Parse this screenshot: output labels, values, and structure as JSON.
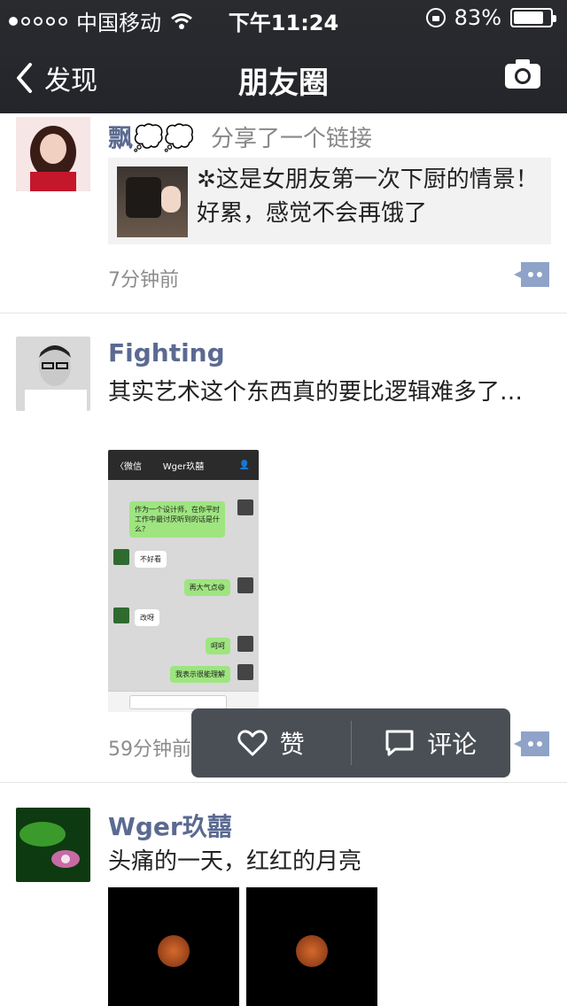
{
  "status_bar": {
    "carrier": "中国移动",
    "time": "下午11:24",
    "battery": "83%",
    "battery_fraction": 0.83,
    "signal_filled": 1,
    "signal_total": 5
  },
  "nav": {
    "back_label": "发现",
    "title": "朋友圈",
    "camera_icon": "camera-icon"
  },
  "posts": [
    {
      "author": "飘💭💭",
      "share_text": "分享了一个链接",
      "link_text": "✲这是女朋友第一次下厨的情景！好累，感觉不会再饿了",
      "time": "7分钟前"
    },
    {
      "author": "Fighting",
      "text": "其实艺术这个东西真的要比逻辑难多了…",
      "time": "59分钟前",
      "screenshot": {
        "header_left": "〈微信",
        "header_title": "Wger玖囍",
        "bubbles": [
          {
            "text": "作为一个设计师，在你平时工作中最讨厌听到的话是什么？",
            "side": "out"
          },
          {
            "text": "不好看",
            "side": "in"
          },
          {
            "text": "再大气点😄",
            "side": "out"
          },
          {
            "text": "改呀",
            "side": "in"
          },
          {
            "text": "呵呵",
            "side": "out"
          },
          {
            "text": "我表示很能理解",
            "side": "out"
          }
        ]
      }
    },
    {
      "author": "Wger玖囍",
      "text": "头痛的一天，红红的月亮"
    }
  ],
  "action_popover": {
    "like_label": "赞",
    "comment_label": "评论"
  },
  "colors": {
    "header_bg": "#24252a",
    "author_name": "#5b6a91",
    "popover_bg": "#4a4f55",
    "comment_icon": "#8fa3c8"
  }
}
